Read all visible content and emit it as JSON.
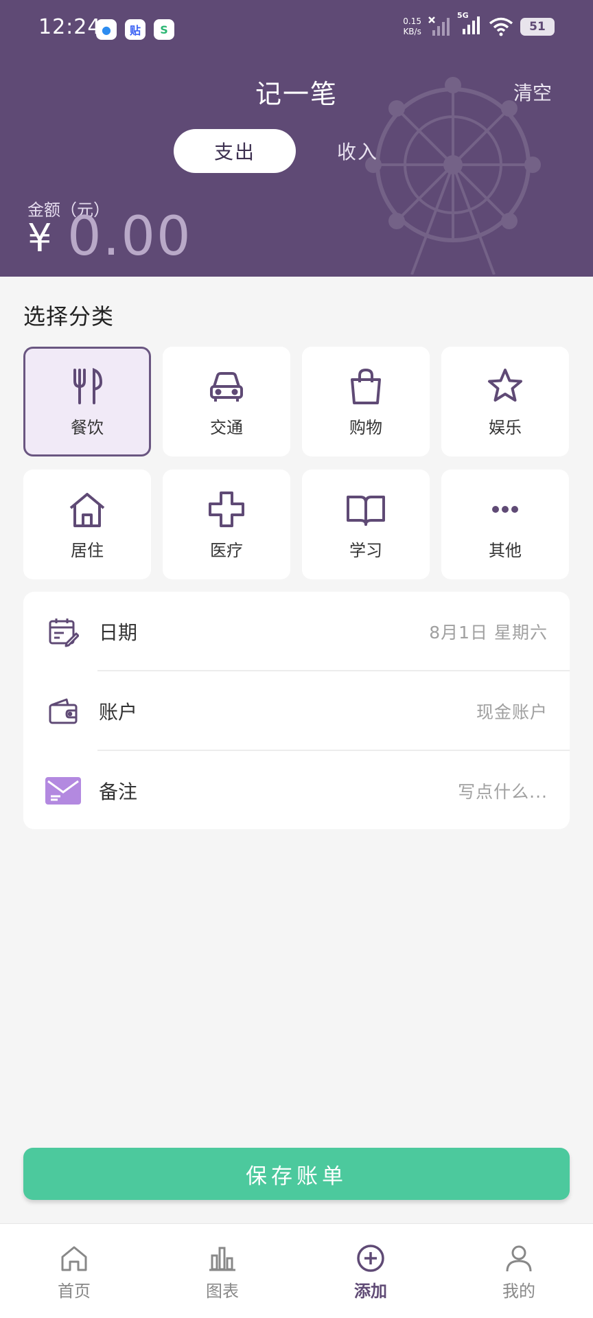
{
  "status_bar": {
    "time": "12:24",
    "net_speed_value": "0.15",
    "net_speed_unit": "KB/s",
    "network": "5G",
    "battery": "51"
  },
  "header": {
    "title": "记一笔",
    "clear_label": "清空",
    "tabs": [
      {
        "label": "支出",
        "active": true
      },
      {
        "label": "收入",
        "active": false
      }
    ],
    "amount_label": "金额（元）",
    "currency_symbol": "¥",
    "amount_value": "0.00"
  },
  "category_section": {
    "title": "选择分类",
    "items": [
      {
        "label": "餐饮",
        "icon": "utensils-icon",
        "selected": true
      },
      {
        "label": "交通",
        "icon": "car-icon",
        "selected": false
      },
      {
        "label": "购物",
        "icon": "shopping-bag-icon",
        "selected": false
      },
      {
        "label": "娱乐",
        "icon": "star-icon",
        "selected": false
      },
      {
        "label": "居住",
        "icon": "house-icon",
        "selected": false
      },
      {
        "label": "医疗",
        "icon": "medical-cross-icon",
        "selected": false
      },
      {
        "label": "学习",
        "icon": "book-icon",
        "selected": false
      },
      {
        "label": "其他",
        "icon": "more-dots-icon",
        "selected": false
      }
    ]
  },
  "details": {
    "date": {
      "label": "日期",
      "value": "8月1日  星期六",
      "icon": "calendar-edit-icon"
    },
    "account": {
      "label": "账户",
      "value": "现金账户",
      "icon": "wallet-icon"
    },
    "note": {
      "label": "备注",
      "placeholder": "写点什么...",
      "icon": "envelope-icon"
    }
  },
  "save_button_label": "保存账单",
  "bottom_nav": [
    {
      "label": "首页",
      "icon": "home-icon",
      "active": false
    },
    {
      "label": "图表",
      "icon": "bar-chart-icon",
      "active": false
    },
    {
      "label": "添加",
      "icon": "add-circle-icon",
      "active": true
    },
    {
      "label": "我的",
      "icon": "profile-icon",
      "active": false
    }
  ],
  "colors": {
    "header_bg": "#5f4a75",
    "accent_purple": "#5f4a75",
    "selected_bg": "#f1eaf7",
    "save_green": "#4cc99d"
  }
}
